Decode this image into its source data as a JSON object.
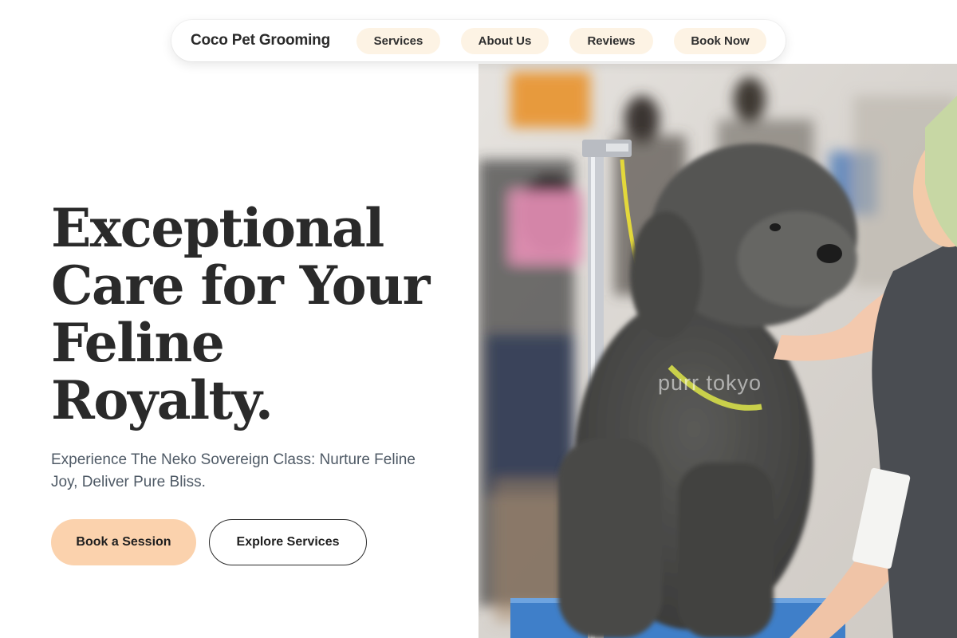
{
  "brand": "Coco Pet Grooming",
  "nav": {
    "items": [
      "Services",
      "About Us",
      "Reviews",
      "Book Now"
    ]
  },
  "hero": {
    "headline_lines": [
      "Exceptional",
      "Care for Your",
      "Feline",
      "Royalty."
    ],
    "subtext": "Experience The Neko Sovereign Class: Nurture Feline Joy, Deliver Pure Bliss.",
    "primary_button": "Book a Session",
    "secondary_button": "Explore Services",
    "image_watermark": "purr tokyo"
  },
  "colors": {
    "nav_pill_bg": "#fdf3e4",
    "primary_button_bg": "#fbd2ad",
    "text_dark": "#2a2a2a",
    "subtext": "#4f5a66"
  }
}
